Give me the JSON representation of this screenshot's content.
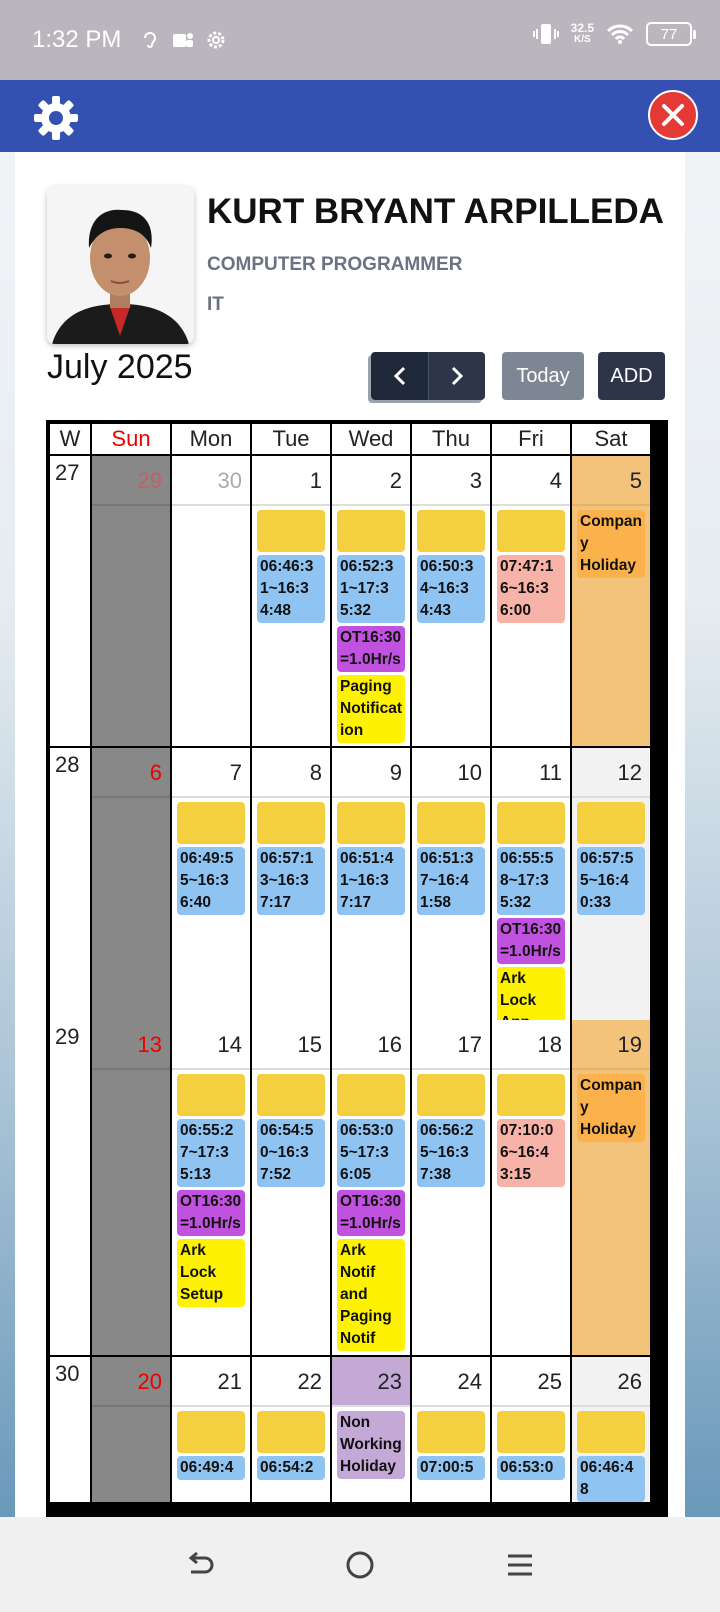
{
  "status_bar": {
    "time": "1:32 PM",
    "speed_value": "32.5",
    "speed_unit": "K/S",
    "battery": "77"
  },
  "profile": {
    "name": "KURT BRYANT ARPILLEDA",
    "position": "COMPUTER PROGRAMMER",
    "department": "IT"
  },
  "calendar_header": {
    "month": "July 2025",
    "prev_icon": "chevron-left-icon",
    "next_icon": "chevron-right-icon",
    "today_label": "Today",
    "add_label": "ADD"
  },
  "columns": [
    "W",
    "Sun",
    "Mon",
    "Tue",
    "Wed",
    "Thu",
    "Fri",
    "Sat"
  ],
  "weeks": [
    {
      "week": "27",
      "days": [
        {
          "num": "29",
          "events": []
        },
        {
          "num": "30",
          "events": []
        },
        {
          "num": "1",
          "events": [
            {
              "type": "yellow",
              "text": ""
            },
            {
              "type": "blue",
              "text": "06:46:31~16:34:48"
            }
          ]
        },
        {
          "num": "2",
          "events": [
            {
              "type": "yellow",
              "text": ""
            },
            {
              "type": "blue",
              "text": "06:52:31~17:35:32"
            },
            {
              "type": "purple",
              "text": "OT16:30=1.0Hr/s"
            },
            {
              "type": "bright",
              "text": "Paging Notification"
            }
          ]
        },
        {
          "num": "3",
          "events": [
            {
              "type": "yellow",
              "text": ""
            },
            {
              "type": "blue",
              "text": "06:50:34~16:34:43"
            }
          ]
        },
        {
          "num": "4",
          "events": [
            {
              "type": "yellow",
              "text": ""
            },
            {
              "type": "pink",
              "text": "07:47:16~16:36:00"
            }
          ]
        },
        {
          "num": "5",
          "events": [
            {
              "type": "orange",
              "text": "Company Holiday"
            }
          ]
        }
      ]
    },
    {
      "week": "28",
      "days": [
        {
          "num": "6",
          "events": []
        },
        {
          "num": "7",
          "events": [
            {
              "type": "yellow",
              "text": ""
            },
            {
              "type": "blue",
              "text": "06:49:55~16:36:40"
            }
          ]
        },
        {
          "num": "8",
          "events": [
            {
              "type": "yellow",
              "text": ""
            },
            {
              "type": "blue",
              "text": "06:57:13~16:37:17"
            }
          ]
        },
        {
          "num": "9",
          "events": [
            {
              "type": "yellow",
              "text": ""
            },
            {
              "type": "blue",
              "text": "06:51:41~16:37:17"
            }
          ]
        },
        {
          "num": "10",
          "events": [
            {
              "type": "yellow",
              "text": ""
            },
            {
              "type": "blue",
              "text": "06:51:37~16:41:58"
            }
          ]
        },
        {
          "num": "11",
          "events": [
            {
              "type": "yellow",
              "text": ""
            },
            {
              "type": "blue",
              "text": "06:55:58~17:35:32"
            },
            {
              "type": "purple",
              "text": "OT16:30=1.0Hr/s"
            },
            {
              "type": "bright",
              "text": "Ark Lock App"
            }
          ]
        },
        {
          "num": "12",
          "events": [
            {
              "type": "yellow",
              "text": ""
            },
            {
              "type": "blue",
              "text": "06:57:55~16:40:33"
            }
          ]
        }
      ]
    },
    {
      "week": "29",
      "days": [
        {
          "num": "13",
          "events": []
        },
        {
          "num": "14",
          "events": [
            {
              "type": "yellow",
              "text": ""
            },
            {
              "type": "blue",
              "text": "06:55:27~17:35:13"
            },
            {
              "type": "purple",
              "text": "OT16:30=1.0Hr/s"
            },
            {
              "type": "bright",
              "text": "Ark Lock Setup"
            }
          ]
        },
        {
          "num": "15",
          "events": [
            {
              "type": "yellow",
              "text": ""
            },
            {
              "type": "blue",
              "text": "06:54:50~16:37:52"
            }
          ]
        },
        {
          "num": "16",
          "events": [
            {
              "type": "yellow",
              "text": ""
            },
            {
              "type": "blue",
              "text": "06:53:05~17:36:05"
            },
            {
              "type": "purple",
              "text": "OT16:30=1.0Hr/s"
            },
            {
              "type": "bright",
              "text": "Ark Notif and Paging Notif"
            }
          ]
        },
        {
          "num": "17",
          "events": [
            {
              "type": "yellow",
              "text": ""
            },
            {
              "type": "blue",
              "text": "06:56:25~16:37:38"
            }
          ]
        },
        {
          "num": "18",
          "events": [
            {
              "type": "yellow",
              "text": ""
            },
            {
              "type": "pink",
              "text": "07:10:06~16:43:15"
            }
          ]
        },
        {
          "num": "19",
          "events": [
            {
              "type": "orange",
              "text": "Company Holiday"
            }
          ]
        }
      ]
    },
    {
      "week": "30",
      "days": [
        {
          "num": "20",
          "events": []
        },
        {
          "num": "21",
          "events": [
            {
              "type": "yellow",
              "text": ""
            },
            {
              "type": "blue",
              "text": "06:49:4"
            }
          ]
        },
        {
          "num": "22",
          "events": [
            {
              "type": "yellow",
              "text": ""
            },
            {
              "type": "blue",
              "text": "06:54:2"
            }
          ]
        },
        {
          "num": "23",
          "events": [
            {
              "type": "lav",
              "text": "Non Working Holiday"
            }
          ]
        },
        {
          "num": "24",
          "events": [
            {
              "type": "yellow",
              "text": ""
            },
            {
              "type": "blue",
              "text": "07:00:5"
            }
          ]
        },
        {
          "num": "25",
          "events": [
            {
              "type": "yellow",
              "text": ""
            },
            {
              "type": "blue",
              "text": "06:53:0"
            }
          ]
        },
        {
          "num": "26",
          "events": [
            {
              "type": "yellow",
              "text": ""
            },
            {
              "type": "blue",
              "text": "06:46:48"
            }
          ]
        }
      ]
    }
  ],
  "colors": {
    "appbar": "#3451b2",
    "close": "#e53935",
    "sunday": "#888888",
    "holiday": "#f3c37c",
    "attendance_normal": "#8fc4f2",
    "attendance_late": "#f8b3a8",
    "overtime": "#c152e0",
    "task": "#fff200"
  }
}
